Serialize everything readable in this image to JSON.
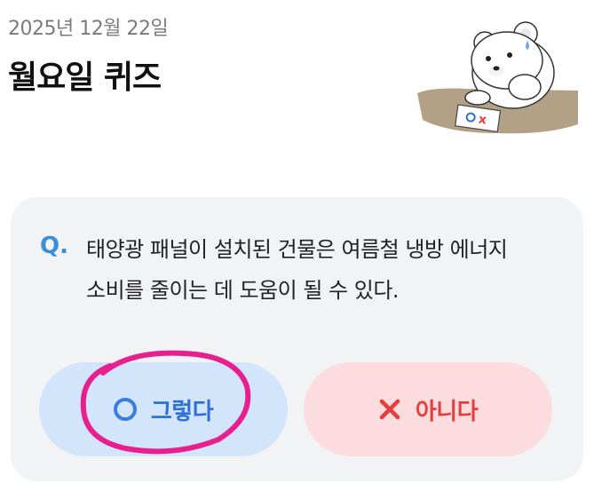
{
  "header": {
    "date": "2025년 12월 22일",
    "title": "월요일 퀴즈"
  },
  "mascot": {
    "icon": "polar-bear-mascot-icon",
    "card_text": "OX"
  },
  "quiz": {
    "q_marker": "Q.",
    "question_line1": "태양광 패널이 설치된 건물은 여름철 냉방 에너지",
    "question_line2": "소비를 줄이는 데 도움이 될 수 있다."
  },
  "answers": {
    "yes_label": "그렇다",
    "yes_icon": "o-circle-icon",
    "no_label": "아니다",
    "no_icon": "x-icon"
  },
  "colors": {
    "accent_blue": "#3a8fd9",
    "yes_bg": "#d2e5fb",
    "no_bg": "#fcdcde",
    "no_red": "#e53e3e",
    "highlight_pink": "#e8208f"
  }
}
